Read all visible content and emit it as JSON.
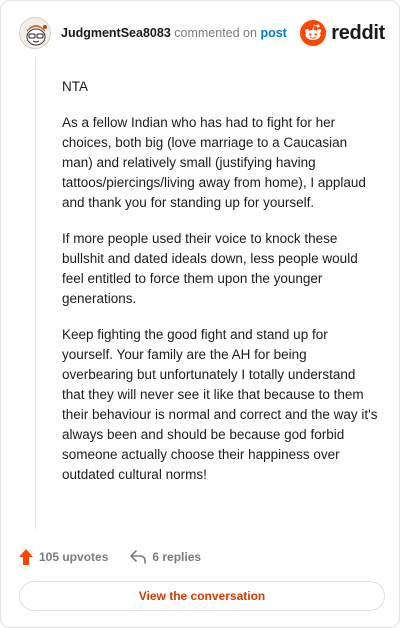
{
  "header": {
    "username": "JudgmentSea8083",
    "commented_text": "commented on",
    "post_link": "post",
    "logo_text": "reddit"
  },
  "comment": {
    "paragraphs": [
      "NTA",
      "As a fellow Indian who has had to fight for her choices, both big (love marriage to a Caucasian man) and relatively small (justifying having tattoos/piercings/living away from home), I applaud and thank you for standing up for yourself.",
      "If more people used their voice to knock these bullshit and dated ideals down, less people would feel entitled to force them upon the younger generations.",
      "Keep fighting the good fight and stand up for yourself. Your family are the AH for being overbearing but unfortunately I totally understand that they will never see it like that because to them their behaviour is normal and correct and the way it's always been and should be because god forbid someone actually choose their happiness over outdated cultural norms!"
    ]
  },
  "actions": {
    "upvotes": "105 upvotes",
    "replies": "6 replies"
  },
  "view_conversation": "View the conversation",
  "colors": {
    "upvote": "#ff4500",
    "link": "#0079d3",
    "button_text": "#d93a00"
  },
  "icons": {
    "avatar": "snoo-avatar-icon",
    "logo": "reddit-logo-icon",
    "upvote": "upvote-arrow-icon",
    "reply": "reply-arrow-icon"
  }
}
